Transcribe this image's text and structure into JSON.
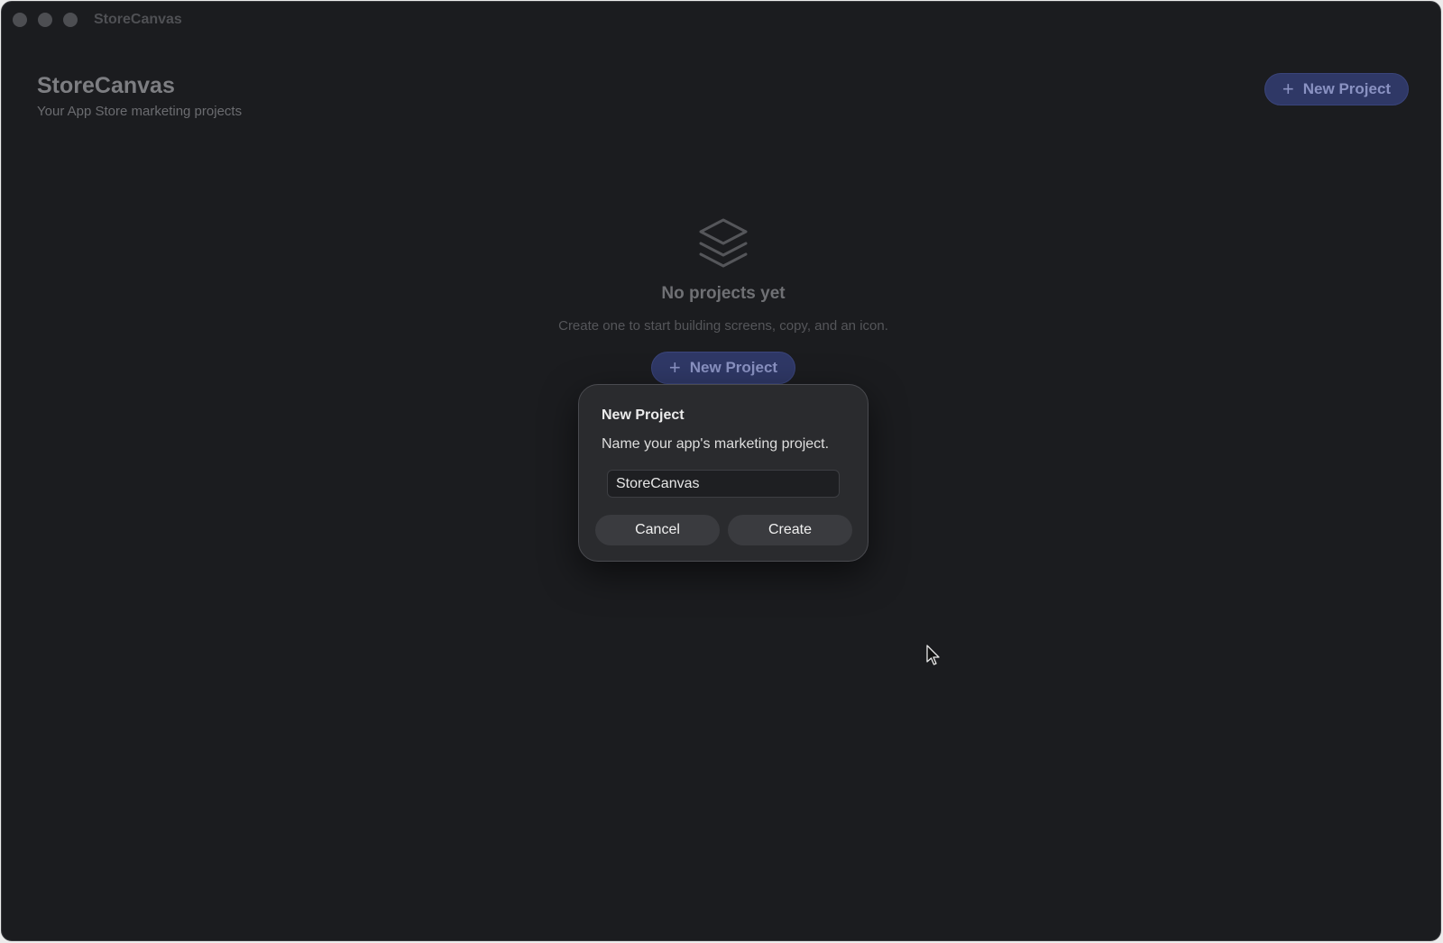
{
  "window": {
    "title": "StoreCanvas"
  },
  "header": {
    "title": "StoreCanvas",
    "subtitle": "Your App Store marketing projects",
    "new_project_label": "New Project"
  },
  "empty_state": {
    "icon": "stack-layers-icon",
    "title": "No projects yet",
    "subtitle": "Create one to start building screens, copy, and an icon.",
    "button_label": "New Project"
  },
  "dialog": {
    "title": "New Project",
    "message": "Name your app's marketing project.",
    "input_value": "StoreCanvas",
    "cancel_label": "Cancel",
    "create_label": "Create"
  },
  "colors": {
    "background": "#1b1c1f",
    "accent": "#2f3866",
    "dialog": "#2a2b2e"
  }
}
